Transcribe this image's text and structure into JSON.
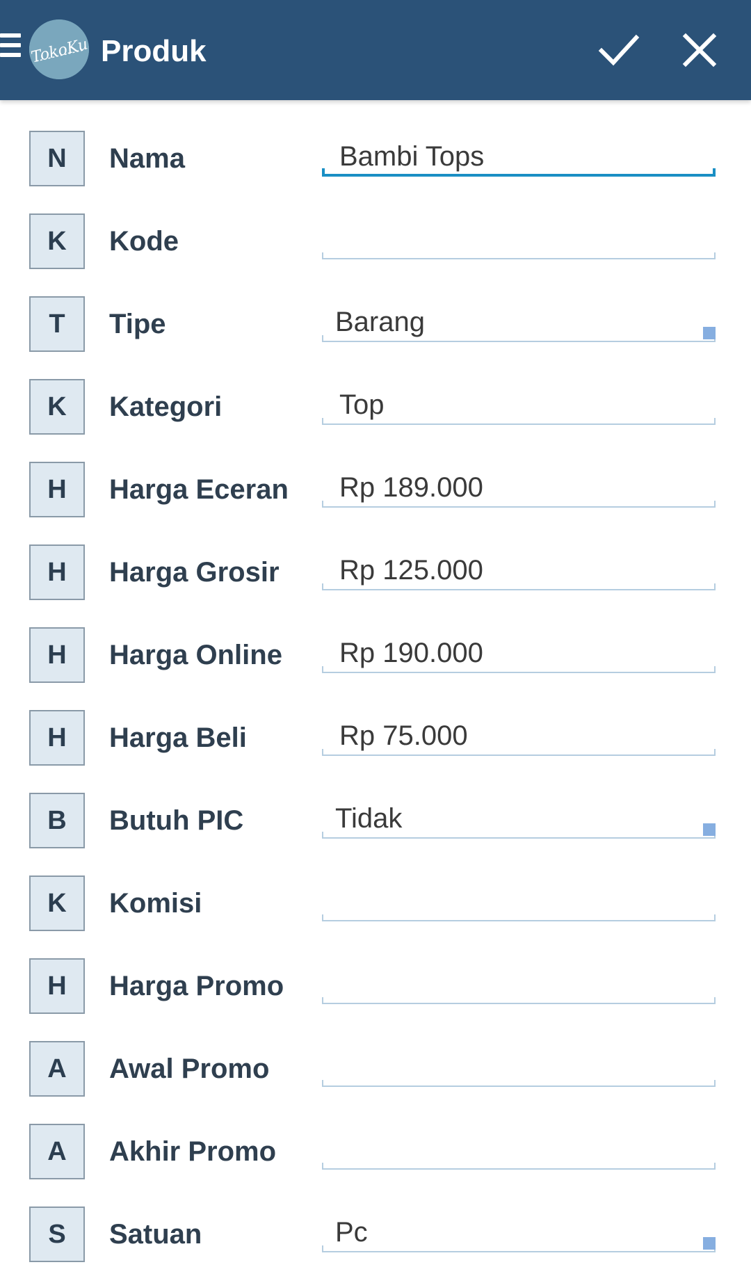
{
  "header": {
    "title": "Produk",
    "logo_text": "TokoKu",
    "background_color": "#2b5278",
    "confirm_icon": "check-icon",
    "close_icon": "close-icon",
    "menu_icon": "hamburger-icon"
  },
  "form": {
    "fields": [
      {
        "letter": "N",
        "label": "Nama",
        "value": "Bambi Tops",
        "type": "text",
        "focused": true
      },
      {
        "letter": "K",
        "label": "Kode",
        "value": "",
        "type": "text"
      },
      {
        "letter": "T",
        "label": "Tipe",
        "value": "Barang",
        "type": "select"
      },
      {
        "letter": "K",
        "label": "Kategori",
        "value": "Top",
        "type": "text"
      },
      {
        "letter": "H",
        "label": "Harga Eceran",
        "value": "Rp 189.000",
        "type": "text"
      },
      {
        "letter": "H",
        "label": "Harga Grosir",
        "value": "Rp 125.000",
        "type": "text"
      },
      {
        "letter": "H",
        "label": "Harga Online",
        "value": "Rp 190.000",
        "type": "text"
      },
      {
        "letter": "H",
        "label": "Harga Beli",
        "value": "Rp 75.000",
        "type": "text"
      },
      {
        "letter": "B",
        "label": "Butuh PIC",
        "value": "Tidak",
        "type": "select"
      },
      {
        "letter": "K",
        "label": "Komisi",
        "value": "",
        "type": "text"
      },
      {
        "letter": "H",
        "label": "Harga Promo",
        "value": "",
        "type": "text"
      },
      {
        "letter": "A",
        "label": "Awal Promo",
        "value": "",
        "type": "text"
      },
      {
        "letter": "A",
        "label": "Akhir Promo",
        "value": "",
        "type": "text"
      },
      {
        "letter": "S",
        "label": "Satuan",
        "value": "Pc",
        "type": "select"
      }
    ]
  }
}
